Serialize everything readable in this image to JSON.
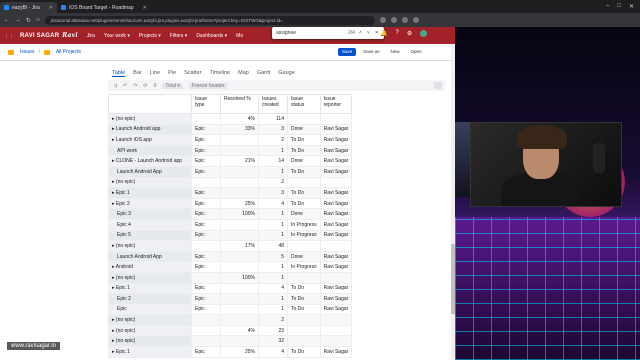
{
  "browser": {
    "tabs": [
      {
        "label": "eazyBI - Jira",
        "active": true
      },
      {
        "label": "IOS Board Target - Roadmap",
        "active": false
      }
    ],
    "url": "jiratutorial.atlassian.net/plugins/servlet/ac/com.eazybi.jira.plugins.eazybi-jira/home?project.key=IOSTWO&project.id="
  },
  "jira": {
    "brand": "RAVI SAGAR",
    "brand_sig": "Ravi",
    "nav": [
      "Jira",
      "Your work ▾",
      "Projects ▾",
      "Filters ▾",
      "Dashboards ▾",
      "Mo"
    ],
    "find": {
      "query": "assignee",
      "count": "2/4"
    }
  },
  "breadcrumbs": [
    "Issues",
    "All Projects"
  ],
  "actions": [
    "Save",
    "Save as",
    "New",
    "Open"
  ],
  "view_tabs": [
    "Table",
    "Bar",
    "Line",
    "Pie",
    "Scatter",
    "Timeline",
    "Map",
    "Gantt",
    "Gauge"
  ],
  "toolbar": {
    "total": "Total ▾",
    "freeze": "Freeze header"
  },
  "table": {
    "headers": [
      "",
      "Issue type",
      "Resolved %",
      "Issues created",
      "Issue status",
      "Issue reporter"
    ],
    "rows": [
      [
        "▸ (no epic)",
        "",
        "4%",
        "114",
        "",
        ""
      ],
      [
        "▸ Launch Android app",
        "Epic",
        "33%",
        "3",
        "Done",
        "Ravi Sagar"
      ],
      [
        "▸ Launch iOS app",
        "Epic",
        "",
        "2",
        "To Do",
        "Ravi Sagar"
      ],
      [
        "API work",
        "Epic",
        "",
        "1",
        "To Do",
        "Ravi Sagar"
      ],
      [
        "▸ CLONE - Launch Android app",
        "Epic",
        "21%",
        "14",
        "Done",
        "Ravi Sagar"
      ],
      [
        "Launch Android App",
        "Epic",
        "",
        "1",
        "To Do",
        "Ravi Sagar"
      ],
      [
        "▸ (no epic)",
        "",
        "",
        "2",
        "",
        ""
      ],
      [
        "▸ Epic 1",
        "Epic",
        "",
        "3",
        "To Do",
        "Ravi Sagar"
      ],
      [
        "▸ Epic 2",
        "Epic",
        "25%",
        "4",
        "To Do",
        "Ravi Sagar"
      ],
      [
        "Epic 3",
        "Epic",
        "100%",
        "1",
        "Done",
        "Ravi Sagar"
      ],
      [
        "Epic 4",
        "Epic",
        "",
        "1",
        "In Progress",
        "Ravi Sagar"
      ],
      [
        "Epic 5",
        "Epic",
        "",
        "1",
        "In Progress",
        "Ravi Sagar"
      ],
      [
        "▸ (no epic)",
        "",
        "17%",
        "48",
        "",
        ""
      ],
      [
        "Launch Android App",
        "Epic",
        "",
        "5",
        "Done",
        "Ravi Sagar"
      ],
      [
        "▸ Android",
        "Epic",
        "",
        "1",
        "In Progress",
        "Ravi Sagar"
      ],
      [
        "▸ (no epic)",
        "",
        "100%",
        "1",
        "",
        ""
      ],
      [
        "▸ Epic 1",
        "Epic",
        "",
        "4",
        "To Do",
        "Ravi Sagar"
      ],
      [
        "Epic 2",
        "Epic",
        "",
        "1",
        "To Do",
        "Ravi Sagar"
      ],
      [
        "Epic",
        "Epic",
        "",
        "1",
        "To Do",
        "Ravi Sagar"
      ],
      [
        "▸ (no epic)",
        "",
        "",
        "2",
        "",
        ""
      ],
      [
        "▸ (no epic)",
        "",
        "4%",
        "23",
        "",
        ""
      ],
      [
        "▸ (no epic)",
        "",
        "",
        "32",
        "",
        ""
      ],
      [
        "▸ Epic 1",
        "Epic",
        "25%",
        "4",
        "To Do",
        "Ravi Sagar"
      ]
    ]
  },
  "watermark": "www.ravisagar.in",
  "colors": {
    "jira_header": "#a3222a",
    "link": "#0052cc"
  }
}
